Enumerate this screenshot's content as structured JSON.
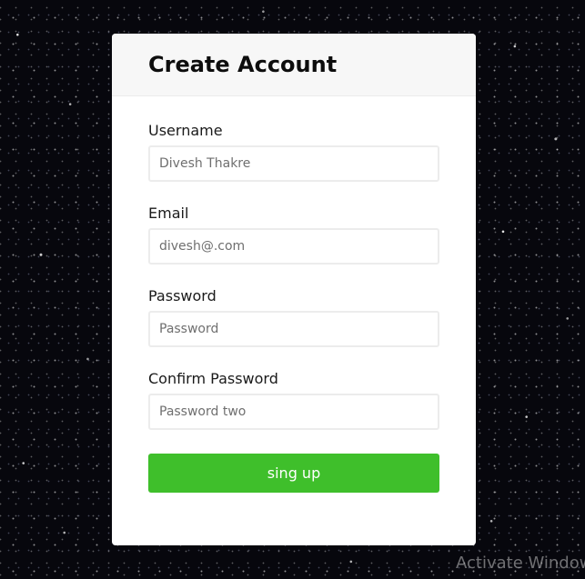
{
  "form": {
    "title": "Create Account",
    "fields": [
      {
        "label": "Username",
        "placeholder": "Divesh Thakre",
        "value": "",
        "type": "text"
      },
      {
        "label": "Email",
        "placeholder": "divesh@.com",
        "value": "",
        "type": "email"
      },
      {
        "label": "Password",
        "placeholder": "Password",
        "value": "",
        "type": "password"
      },
      {
        "label": "Confirm Password",
        "placeholder": "Password two",
        "value": "",
        "type": "password"
      }
    ],
    "submit_label": "sing up"
  },
  "watermark": {
    "text": "Activate Window"
  },
  "colors": {
    "accent": "#3fbf2b",
    "background": "#07070d",
    "card": "#ffffff",
    "header": "#f7f7f7"
  },
  "background_image": "starry-night-sky"
}
